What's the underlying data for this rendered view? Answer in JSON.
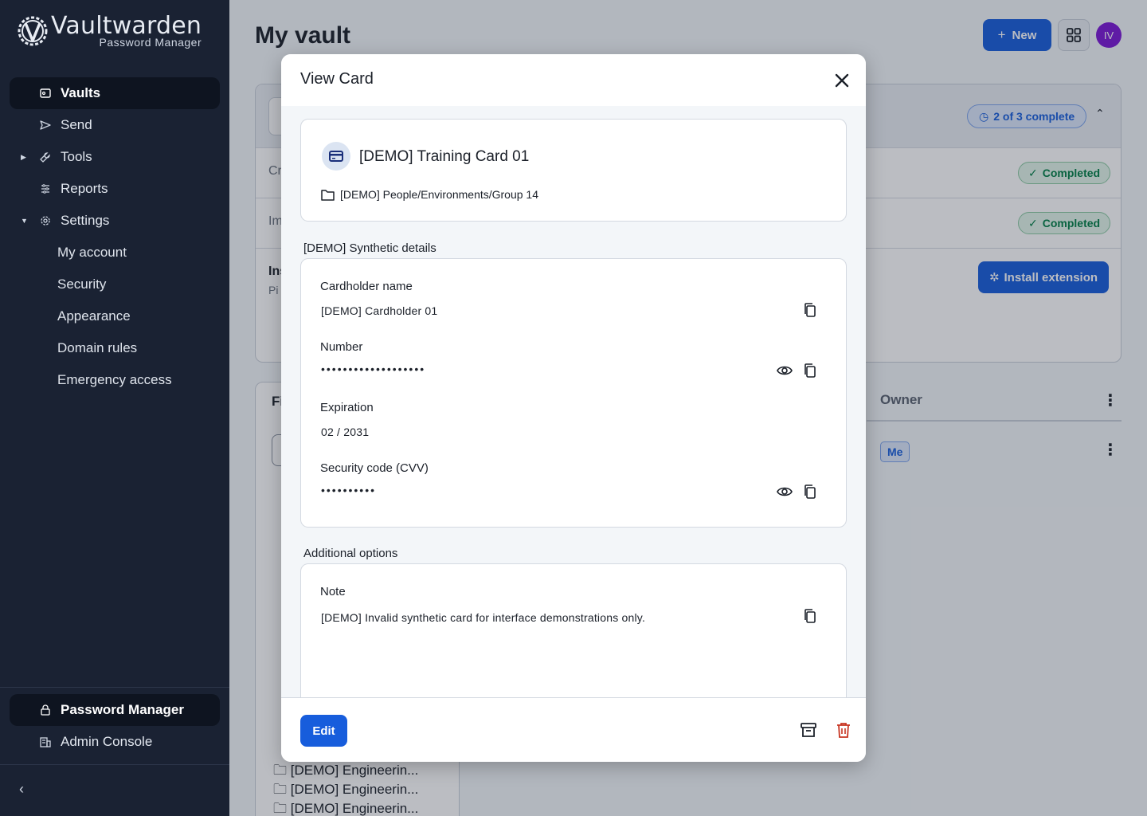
{
  "sidebar": {
    "brand_title": "Vaultwarden",
    "brand_subtitle": "Password Manager",
    "items": [
      {
        "label": "Vaults"
      },
      {
        "label": "Send"
      },
      {
        "label": "Tools"
      },
      {
        "label": "Reports"
      },
      {
        "label": "Settings"
      }
    ],
    "settings_items": [
      {
        "label": "My account"
      },
      {
        "label": "Security"
      },
      {
        "label": "Appearance"
      },
      {
        "label": "Domain rules"
      },
      {
        "label": "Emergency access"
      }
    ],
    "bottom_items": [
      {
        "label": "Password Manager"
      },
      {
        "label": "Admin Console"
      }
    ]
  },
  "header": {
    "title": "My vault",
    "new_label": "New",
    "avatar_initials": "IV"
  },
  "setup": {
    "progress_label": "2 of 3 complete",
    "row1_text": "Cr",
    "row2_text": "Im",
    "row3_text": "Ins",
    "row3_sub": "Pi",
    "completed_label": "Completed",
    "install_label": "Install extension"
  },
  "filters": {
    "title": "Fi",
    "folders": [
      "[DEMO] Engineerin...",
      "[DEMO] Engineerin...",
      "[DEMO] Engineerin..."
    ]
  },
  "table": {
    "owner_header": "Owner",
    "owner_value": "Me"
  },
  "dialog": {
    "title": "View Card",
    "item_name": "[DEMO] Training Card 01",
    "folder_path": "[DEMO] People/Environments/Group 14",
    "details_section": "[DEMO] Synthetic details",
    "cardholder_label": "Cardholder name",
    "cardholder_value": "[DEMO] Cardholder 01",
    "number_label": "Number",
    "number_mask": "•••••••••••••••••••",
    "expiration_label": "Expiration",
    "expiration_value": "02 / 2031",
    "cvv_label": "Security code (CVV)",
    "cvv_mask": "••••••••••",
    "additional_section": "Additional options",
    "note_label": "Note",
    "note_value": "[DEMO] Invalid synthetic card for interface demonstrations only.",
    "edit_label": "Edit"
  },
  "colors": {
    "accent": "#175ddc",
    "danger": "#c83522",
    "sidebar_bg": "#1a2233",
    "success": "#017e45"
  }
}
